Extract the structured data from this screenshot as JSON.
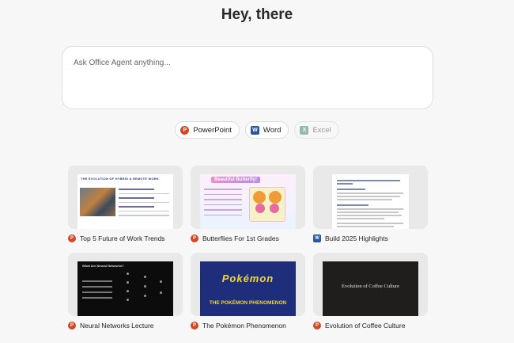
{
  "header": {
    "title": "Hey, there"
  },
  "prompt": {
    "placeholder": "Ask Office Agent anything...",
    "value": ""
  },
  "apps": [
    {
      "label": "PowerPoint",
      "icon": "powerpoint-icon",
      "color": "#d24726",
      "enabled": true
    },
    {
      "label": "Word",
      "icon": "word-icon",
      "color": "#2b579a",
      "enabled": true
    },
    {
      "label": "Excel",
      "icon": "excel-icon",
      "color": "#217346",
      "enabled": false
    }
  ],
  "cards": [
    {
      "title": "Top 5 Future of Work Trends",
      "app": "powerpoint",
      "thumb_heading": "THE EVOLUTION OF HYBRID & REMOTE WORK"
    },
    {
      "title": "Butterflies For 1st Grades",
      "app": "powerpoint",
      "thumb_heading": "Beautiful Butterfly!"
    },
    {
      "title": "Build 2025 Highlights",
      "app": "word"
    },
    {
      "title": "Neural Networks Lecture",
      "app": "powerpoint",
      "thumb_heading": "What Are Neural Networks?"
    },
    {
      "title": "The Pokémon Phenomenon",
      "app": "powerpoint",
      "thumb_heading": "Pokémon",
      "thumb_subtitle": "THE POKÉMON PHENOMENON"
    },
    {
      "title": "Evolution of Coffee Culture",
      "app": "powerpoint",
      "thumb_heading": "Evolution of Coffee Culture"
    }
  ]
}
